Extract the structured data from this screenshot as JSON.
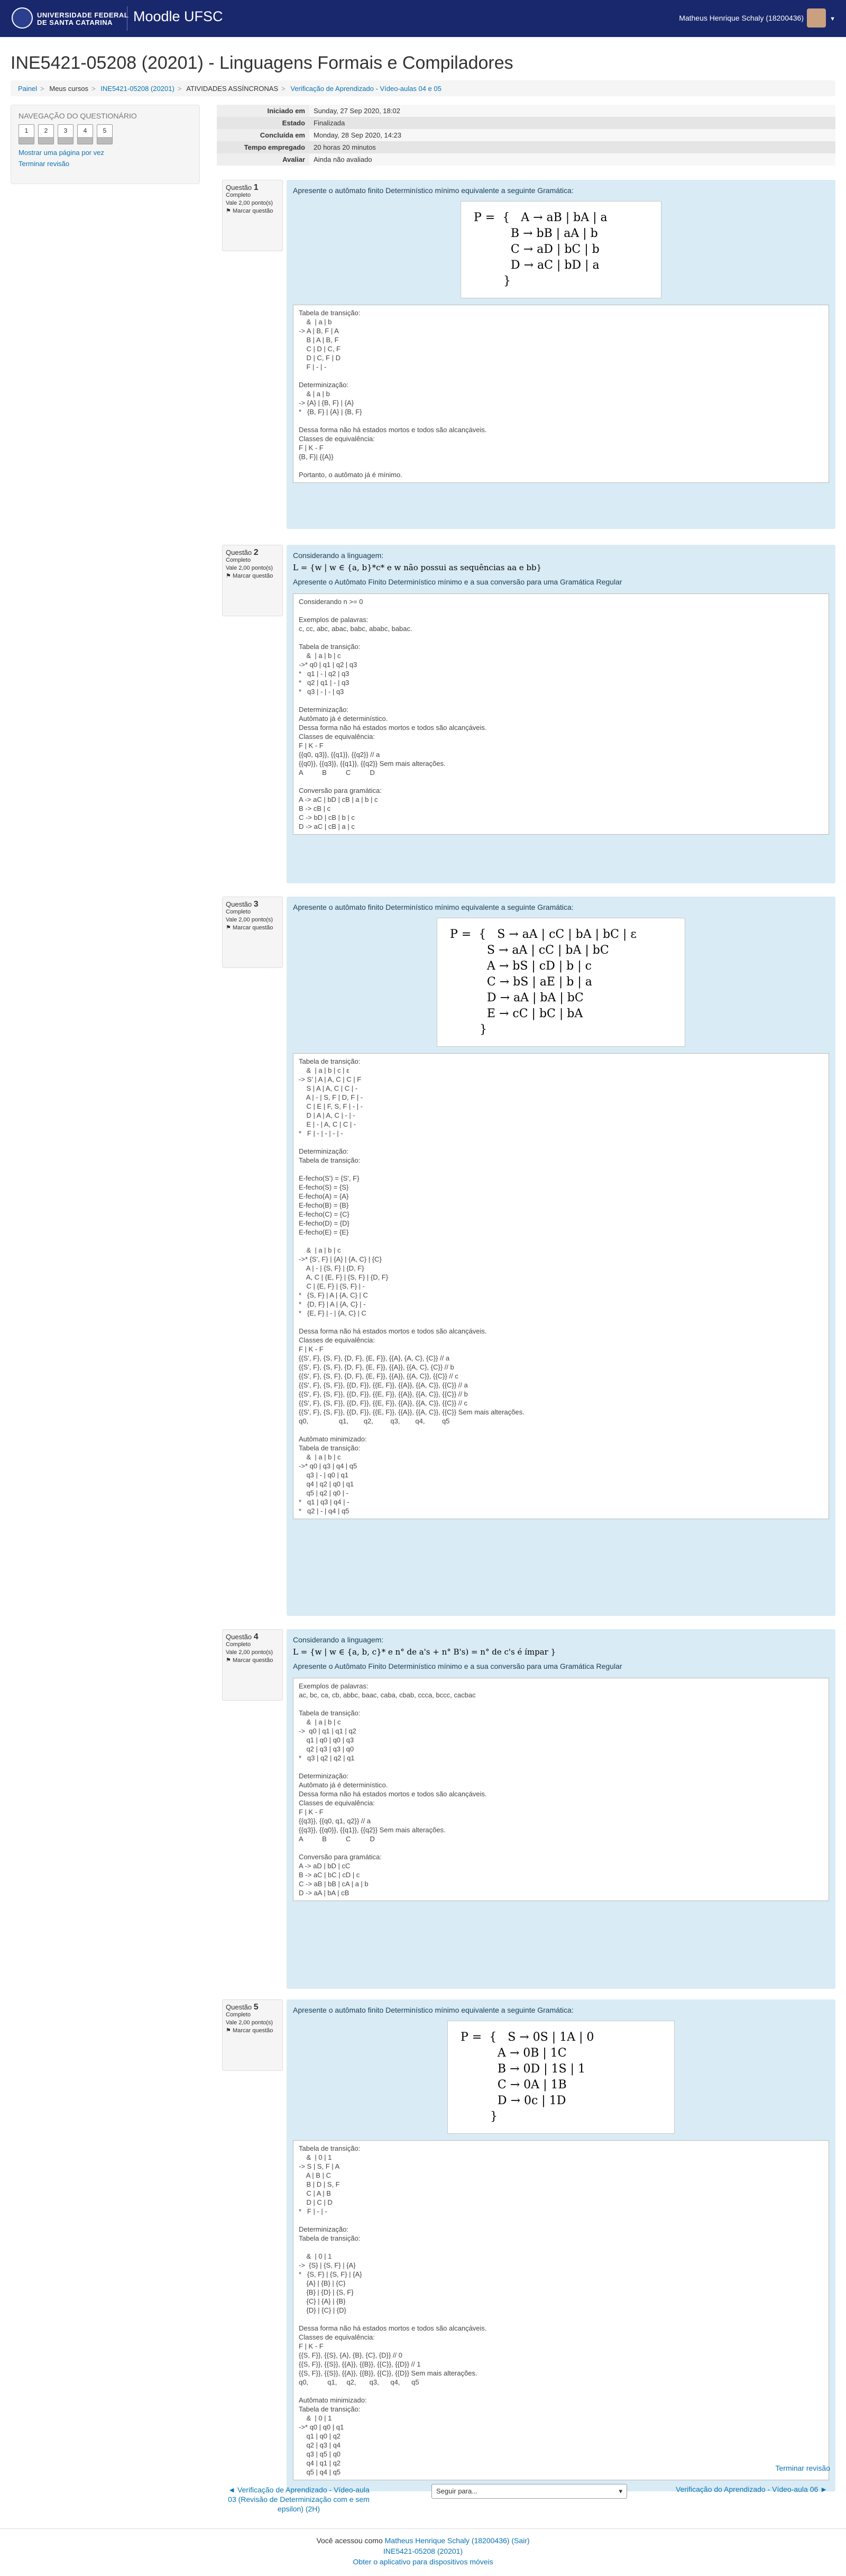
{
  "header": {
    "brand": "Moodle UFSC",
    "uni_line1": "UNIVERSIDADE FEDERAL",
    "uni_line2": "DE SANTA CATARINA",
    "user": "Matheus Henrique Schaly (18200436)"
  },
  "page": {
    "title": "INE5421-05208 (20201) - Linguagens Formais e Compiladores"
  },
  "breadcrumb": [
    "Painel",
    "Meus cursos",
    "INE5421-05208 (20201)",
    "ATIVIDADES ASSÍNCRONAS",
    "Verificação de Aprendizado - Vídeo-aulas 04 e 05"
  ],
  "nav": {
    "title": "NAVEGAÇÃO DO QUESTIONÁRIO",
    "buttons": [
      "1",
      "2",
      "3",
      "4",
      "5"
    ],
    "show_one_page": "Mostrar uma página por vez",
    "finish_review": "Terminar revisão"
  },
  "summary": [
    [
      "Iniciado em",
      "Sunday, 27 Sep 2020, 18:02"
    ],
    [
      "Estado",
      "Finalizada"
    ],
    [
      "Concluída em",
      "Monday, 28 Sep 2020, 14:23"
    ],
    [
      "Tempo empregado",
      "20 horas 20 minutos"
    ],
    [
      "Avaliar",
      "Ainda não avaliado"
    ]
  ],
  "questions": [
    {
      "label": "Questão",
      "num": "1",
      "status": "Completo",
      "value": "Vale 2,00 ponto(s)",
      "flag": "Marcar questão",
      "text": "Apresente o autômato finito Determinístico mínimo equivalente a seguinte Gramática:",
      "formula": [
        "P =  {   A → aB | bA | a",
        "          B → bB | aA | b",
        "          C → aD | bC | b",
        "          D → aC | bD | a",
        "        }"
      ],
      "answer": [
        "Tabela de transição:",
        "    &  | a | b",
        "-> A | B, F | A",
        "    B | A | B, F",
        "    C | D | C, F",
        "    D | C, F | D",
        "    F | - | -",
        "",
        "Determinização:",
        "    & | a | b",
        "-> {A} | {B, F} | {A}",
        "*   {B, F} | {A} | {B, F}",
        "",
        "Dessa forma não há estados mortos e todos são alcançáveis.",
        "Classes de equivalência:",
        "F | K - F",
        "{B, F}| {{A}}",
        "",
        "Portanto, o autômato já é mínimo."
      ]
    },
    {
      "label": "Questão",
      "num": "2",
      "status": "Completo",
      "value": "Vale 2,00 ponto(s)",
      "flag": "Marcar questão",
      "text": "Considerando a linguagem:",
      "lang": "L = {w | w ∈ {a, b}*c* e w não possui as sequências aa e bb}",
      "text2": "Apresente o Autômato Finito Determinístico mínimo e a sua conversão para uma Gramática Regular",
      "answer": [
        "Considerando n >= 0",
        "",
        "Exemplos de palavras:",
        "c, cc, abc, abac, babc, ababc, babac.",
        "",
        "Tabela de transição:",
        "    &  | a | b | c",
        "->* q0 | q1 | q2 | q3",
        "*   q1 | - | q2 | q3",
        "*   q2 | q1 | - | q3",
        "*   q3 | - | - | q3",
        "",
        "Determinização:",
        "Autômato já é determinístico.",
        "Dessa forma não há estados mortos e todos são alcançáveis.",
        "Classes de equivalência:",
        "F | K - F",
        "{{q0, q3}}, {{q1}}, {{q2}} // a",
        "{{q0}}, {{q3}}, {{q1}}, {{q2}} Sem mais alterações.",
        "A          B          C          D",
        "",
        "Conversão para gramática:",
        "A -> aC | bD | cB | a | b | c",
        "B -> cB | c",
        "C -> bD | cB | b | c",
        "D -> aC | cB | a | c"
      ]
    },
    {
      "label": "Questão",
      "num": "3",
      "status": "Completo",
      "value": "Vale 2,00 ponto(s)",
      "flag": "Marcar questão",
      "text": "Apresente o autômato finito Determinístico mínimo equivalente a seguinte Gramática:",
      "formula": [
        "P =  {   S → aA | cC | bA | bC | ε",
        "          S → aA | cC | bA | bC",
        "          A → bS | cD | b | c",
        "          C → bS | aE | b | a",
        "          D → aA | bA | bC",
        "          E → cC | bC | bA",
        "        }"
      ],
      "answer": [
        "Tabela de transição:",
        "    &  | a | b | c | ε",
        "-> S' | A | A, C | C | F",
        "    S | A | A, C | C | -",
        "    A | - | S, F | D, F | -",
        "    C | E | F, S, F | - | -",
        "    D | A | A, C | - | -",
        "    E | - | A, C | C | -",
        "*   F | - | - | - | -",
        "",
        "Determinização:",
        "Tabela de transição:",
        "",
        "E-fecho(S') = {S', F}",
        "E-fecho(S) = {S}",
        "E-fecho(A) = {A}",
        "E-fecho(B) = {B}",
        "E-fecho(C) = {C}",
        "E-fecho(D) = {D}",
        "E-fecho(E) = {E}",
        "",
        "    &  | a | b | c",
        "->* {S', F} | {A} | {A, C} | {C}",
        "    A | - | {S, F} | {D, F}",
        "    A, C | {E, F} | {S, F} | {D, F}",
        "    C | {E, F} | {S, F} | -",
        "*   {S, F} | A | {A, C} | C",
        "*   {D, F} | A | {A, C} | -",
        "*   {E, F} | - | {A, C} | C",
        "",
        "Dessa forma não há estados mortos e todos são alcançáveis.",
        "Classes de equivalência:",
        "F | K - F",
        "{{S', F}, {S, F}, {D, F}, {E, F}}, {{A}, {A, C}, {C}} // a",
        "{{S', F}, {S, F}, {D, F}, {E, F}}, {{A}}, {{A, C}, {C}} // b",
        "{{S', F}, {S, F}, {D, F}, {E, F}}, {{A}}, {{A, C}}, {{C}} // c",
        "{{S', F}, {S, F}}, {{D, F}}, {{E, F}}, {{A}}, {{A, C}}, {{C}} // a",
        "{{S', F}, {S, F}}, {{D, F}}, {{E, F}}, {{A}}, {{A, C}}, {{C}} // b",
        "{{S', F}, {S, F}}, {{D, F}}, {{E, F}}, {{A}}, {{A, C}}, {{C}} // c",
        "{{S', F}, {S, F}}, {{D, F}}, {{E, F}}, {{A}}, {{A, C}}, {{C}} Sem mais alterações.",
        "q0,                q1,        q2,         q3,        q4,         q5",
        "",
        "Autômato minimizado:",
        "Tabela de transição:",
        "    &  | a | b | c",
        "->* q0 | q3 | q4 | q5",
        "    q3 | - | q0 | q1",
        "    q4 | q2 | q0 | q1",
        "    q5 | q2 | q0 | -",
        "*   q1 | q3 | q4 | -",
        "*   q2 | - | q4 | q5"
      ]
    },
    {
      "label": "Questão",
      "num": "4",
      "status": "Completo",
      "value": "Vale 2,00 ponto(s)",
      "flag": "Marcar questão",
      "text": "Considerando a linguagem:",
      "lang": "L = {w | w ∈ {a, b, c}* e n° de a's + n° B's) = n° de c's é ímpar }",
      "text2": "Apresente o Autômato Finito Determinístico mínimo e a sua conversão para uma Gramática Regular",
      "answer": [
        "Exemplos de palavras:",
        "ac, bc, ca, cb, abbc, baac, caba, cbab, ccca, bccc, cacbac",
        "",
        "Tabela de transição:",
        "    &  | a | b | c",
        "->  q0 | q1 | q1 | q2",
        "    q1 | q0 | q0 | q3",
        "    q2 | q3 | q3 | q0",
        "*   q3 | q2 | q2 | q1",
        "",
        "Determinização:",
        "Autômato já é determinístico.",
        "Dessa forma não há estados mortos e todos são alcançáveis.",
        "Classes de equivalência:",
        "F | K - F",
        "{{q3}}, {{q0, q1, q2}} // a",
        "{{q3}}, {{q0}}, {{q1}}, {{q2}} Sem mais alterações.",
        "A          B          C          D",
        "",
        "Conversão para gramática:",
        "A -> aD | bD | cC",
        "B -> aC | bC | cD | c",
        "C -> aB | bB | cA | a | b",
        "D -> aA | bA | cB"
      ]
    },
    {
      "label": "Questão",
      "num": "5",
      "status": "Completo",
      "value": "Vale 2,00 ponto(s)",
      "flag": "Marcar questão",
      "text": "Apresente o autômato finito Determinístico mínimo equivalente a seguinte Gramática:",
      "formula": [
        "P =  {   S → 0S | 1A | 0",
        "          A → 0B | 1C",
        "          B → 0D | 1S | 1",
        "          C → 0A | 1B",
        "          D → 0c | 1D",
        "        }"
      ],
      "answer": [
        "Tabela de transição:",
        "    &  | 0 | 1",
        "-> S | S, F | A",
        "    A | B | C",
        "    B | D | S, F",
        "    C | A | B",
        "    D | C | D",
        "*   F | - | -",
        "",
        "Determinização:",
        "Tabela de transição:",
        "",
        "    &  | 0 | 1",
        "->  {S} | {S, F} | {A}",
        "*   {S, F} | {S, F} | {A}",
        "    {A} | {B} | {C}",
        "    {B} | {D} | {S, F}",
        "    {C} | {A} | {B}",
        "    {D} | {C} | {D}",
        "",
        "Dessa forma não há estados mortos e todos são alcançáveis.",
        "Classes de equivalência:",
        "F | K - F",
        "{{S, F}}, {{S}, {A}, {B}, {C}, {D}} // 0",
        "{{S, F}}, {{S}}, {{A}}, {{B}}, {{C}}, {{D}} // 1",
        "{{S, F}}, {{S}}, {{A}}, {{B}}, {{C}}, {{D}} Sem mais alterações.",
        "q0,          q1,     q2,       q3,      q4,      q5",
        "",
        "Autômato minimizado:",
        "Tabela de transição:",
        "    &  | 0 | 1",
        "->* q0 | q0 | q1",
        "    q1 | q0 | q2",
        "    q2 | q3 | q4",
        "    q3 | q5 | q0",
        "    q4 | q1 | q2",
        "    q5 | q4 | q5"
      ]
    }
  ],
  "bottom": {
    "finish": "Terminar revisão",
    "prev": "◄ Verificação de Aprendizado - Vídeo-aula 03 (Revisão de Determinização com e sem epsilon) (2H)",
    "jump": "Seguir para...",
    "next": "Verificação do Aprendizado - Vídeo-aula 06 ►"
  },
  "footer": {
    "line1a": "Você acessou como ",
    "user": "Matheus Henrique Schaly (18200436)",
    "logout": "(Sair)",
    "course": "INE5421-05208 (20201)",
    "app": "Obter o aplicativo para dispositivos móveis"
  }
}
